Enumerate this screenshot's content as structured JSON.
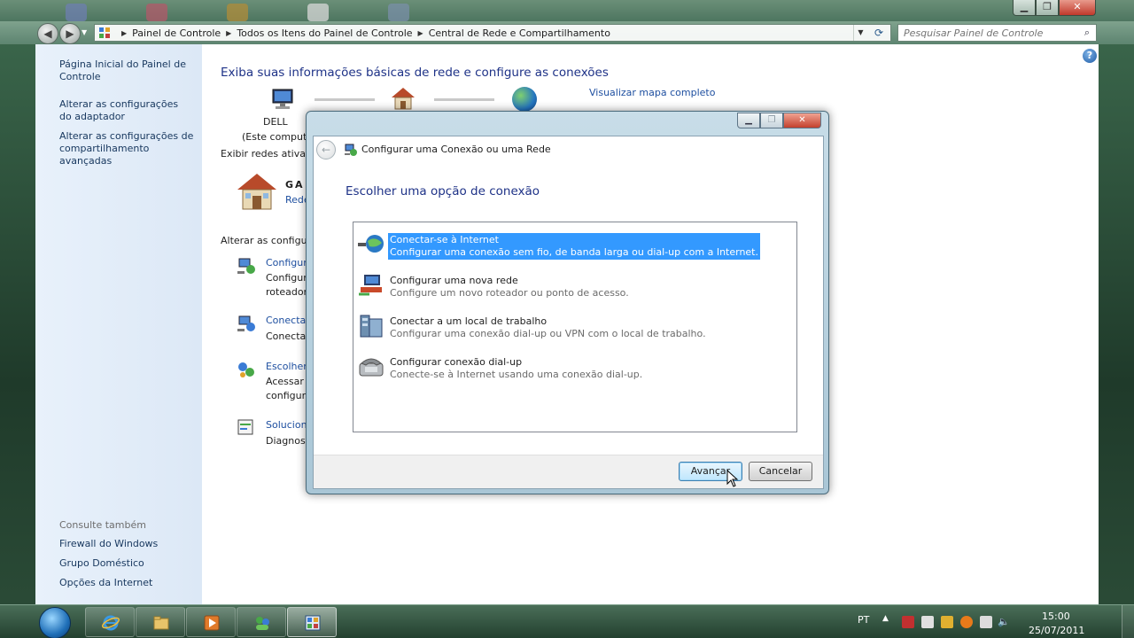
{
  "colors": {
    "link": "#1e4fa0",
    "heading": "#1e3287",
    "selection": "#3399ff",
    "left_pane_link": "#17375e"
  },
  "breadcrumb": [
    "Painel de Controle",
    "Todos os Itens do Painel de Controle",
    "Central de Rede e Compartilhamento"
  ],
  "search": {
    "placeholder": "Pesquisar Painel de Controle"
  },
  "left_pane": {
    "home": "Página Inicial do Painel de Controle",
    "adapter": "Alterar as configurações do adaptador",
    "sharing": "Alterar as configurações de compartilhamento avançadas",
    "see_also": "Consulte também",
    "firewall": "Firewall do Windows",
    "homegroup": "Grupo Doméstico",
    "internet_options": "Opções da Internet"
  },
  "main": {
    "title": "Exiba suas informações básicas de rede e configure as conexões",
    "view_full_map": "Visualizar mapa completo",
    "computer_name": "DELL",
    "computer_sub": "(Este computad",
    "active_networks": "Exibir redes ativas",
    "network_name": "GA",
    "network_type": "Rede",
    "change_settings": "Alterar as configura",
    "tasks": [
      {
        "link": "Configur",
        "desc": "Configura\nroteador",
        "icon": "setup-connection-icon"
      },
      {
        "link": "Conectar",
        "desc": "Conectar",
        "icon": "connect-network-icon"
      },
      {
        "link": "Escolher",
        "desc": "Acessar a\nconfigura",
        "icon": "homegroup-icon"
      },
      {
        "link": "Soluciona",
        "desc": "Diagnosti",
        "icon": "troubleshoot-icon"
      }
    ]
  },
  "dialog": {
    "title": "Configurar uma Conexão ou uma Rede",
    "heading": "Escolher uma opção de conexão",
    "selected_index": 0,
    "options": [
      {
        "title": "Conectar-se à Internet",
        "desc": "Configurar uma conexão sem fio, de banda larga ou dial-up com a Internet.",
        "icon": "globe-cable-icon"
      },
      {
        "title": "Configurar uma nova rede",
        "desc": "Configure um novo roteador ou ponto de acesso.",
        "icon": "router-icon"
      },
      {
        "title": "Conectar a um local de trabalho",
        "desc": "Configurar uma conexão dial-up ou VPN com o local de trabalho.",
        "icon": "workplace-icon"
      },
      {
        "title": "Configurar conexão dial-up",
        "desc": "Conecte-se à Internet usando uma conexão dial-up.",
        "icon": "phone-icon"
      }
    ],
    "next_label": "Avançar",
    "cancel_label": "Cancelar"
  },
  "taskbar": {
    "language": "PT",
    "time": "15:00",
    "date": "25/07/2011"
  }
}
